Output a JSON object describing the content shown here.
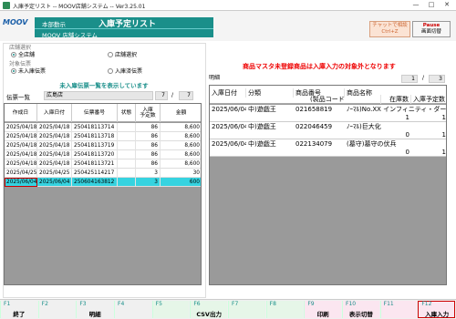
{
  "window": {
    "title": "入庫予定リスト -- MOOV店舗システム -- Ver3.25.01",
    "minimize": "—",
    "maximize": "□",
    "close": "✕"
  },
  "header": {
    "logo": "MOOV",
    "dept": "本部勤示",
    "page_title": "入庫予定リスト",
    "system_name": "MOOV 店舗システム",
    "chat_line1": "チャットで相談",
    "chat_line2": "Ctrl+Z",
    "pause_line1": "Pause",
    "pause_line2": "画面切替"
  },
  "filters": {
    "store_select_label": "店舗選択",
    "all_stores": "全店舗",
    "store_select_opt": "店舗選択",
    "target_label": "対象伝票",
    "unreceived": "未入庫伝票",
    "received": "入庫済伝票"
  },
  "warning": "商品マスタ未登録商品は入庫入力の対象外となります",
  "left": {
    "info": "未入庫伝票一覧を表示しています",
    "list_label": "伝票一覧",
    "store_name": "広島店",
    "count_a": "7",
    "count_sep": "/",
    "count_b": "7",
    "headers": [
      "作成日",
      "入庫日付",
      "伝票番号",
      "状態",
      "入庫\n予定数",
      "金額"
    ],
    "rows": [
      [
        "2025/04/18",
        "2025/04/18",
        "250418113714",
        "",
        "86",
        "8,600"
      ],
      [
        "2025/04/18",
        "2025/04/18",
        "250418113718",
        "",
        "86",
        "8,600"
      ],
      [
        "2025/04/18",
        "2025/04/18",
        "250418113719",
        "",
        "86",
        "8,600"
      ],
      [
        "2025/04/18",
        "2025/04/18",
        "250418113720",
        "",
        "86",
        "8,600"
      ],
      [
        "2025/04/18",
        "2025/04/18",
        "250418113721",
        "",
        "86",
        "8,600"
      ],
      [
        "2025/04/25",
        "2025/04/25",
        "250425114217",
        "",
        "3",
        "30"
      ],
      [
        "2025/06/04",
        "2025/06/04",
        "250604163812",
        "",
        "3",
        "600"
      ]
    ]
  },
  "right": {
    "detail_label": "明細",
    "page_current": "1",
    "page_sep": "/",
    "page_total": "3",
    "headers": {
      "date": "入庫日付",
      "category": "分類",
      "product_no": "商品番号",
      "product_name": "商品名称",
      "jan": "(製品コード",
      "stock": "在庫数",
      "planned": "入庫予定数"
    },
    "rows": [
      {
        "date": "2025/06/04",
        "category": "中)遊戯王",
        "product_no": "021658819",
        "product_name": "ﾉｰﾏﾙ)No.XX インフィニティ・ダークホー",
        "stock": "1",
        "planned": "1"
      },
      {
        "date": "2025/06/04",
        "category": "中)遊戯王",
        "product_no": "022046459",
        "product_name": "ﾉｰﾏﾙ)巨大化",
        "stock": "0",
        "planned": "1"
      },
      {
        "date": "2025/06/04",
        "category": "中)遊戯王",
        "product_no": "022134079",
        "product_name": "(墓守)墓守の伏兵",
        "stock": "0",
        "planned": "1"
      }
    ]
  },
  "fkeys": [
    {
      "key": "F1",
      "label": "終了"
    },
    {
      "key": "F2",
      "label": ""
    },
    {
      "key": "F3",
      "label": "明細"
    },
    {
      "key": "F4",
      "label": ""
    },
    {
      "key": "F5",
      "label": ""
    },
    {
      "key": "F6",
      "label": "CSV出力"
    },
    {
      "key": "F7",
      "label": ""
    },
    {
      "key": "F8",
      "label": ""
    },
    {
      "key": "F9",
      "label": "印刷"
    },
    {
      "key": "F10",
      "label": "表示切替"
    },
    {
      "key": "F11",
      "label": ""
    },
    {
      "key": "F12",
      "label": "入庫入力"
    }
  ]
}
